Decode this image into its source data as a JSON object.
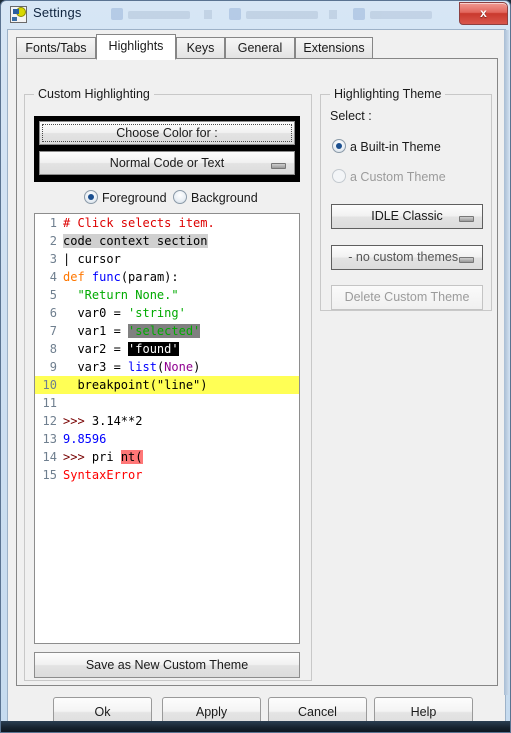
{
  "window": {
    "title": "Settings",
    "icon": "python-idle-icon",
    "close_label": "x"
  },
  "tabs": [
    {
      "label": "Fonts/Tabs",
      "active": false
    },
    {
      "label": "Highlights",
      "active": true
    },
    {
      "label": "Keys",
      "active": false
    },
    {
      "label": "General",
      "active": false
    },
    {
      "label": "Extensions",
      "active": false
    }
  ],
  "custom_highlighting": {
    "group_title": "Custom Highlighting",
    "choose_color_label": "Choose Color for :",
    "target_element": "Normal Code or Text",
    "fg_label": "Foreground",
    "bg_label": "Background",
    "fg_selected": true,
    "bg_selected": false,
    "save_theme_label": "Save as New Custom Theme"
  },
  "highlighting_theme": {
    "group_title": "Highlighting Theme",
    "select_label": "Select :",
    "builtin_label": "a Built-in Theme",
    "custom_label": "a Custom Theme",
    "builtin_selected": true,
    "custom_selected": false,
    "builtin_theme": "IDLE Classic",
    "custom_theme": "- no custom themes -",
    "delete_label": "Delete Custom Theme"
  },
  "code_sample": {
    "lines": [
      {
        "n": "1",
        "text": "# Click selects item."
      },
      {
        "n": "2",
        "text": "code context section"
      },
      {
        "n": "3",
        "text": "| cursor"
      },
      {
        "n": "4",
        "text": "def func(param):"
      },
      {
        "n": "5",
        "text": "  \"Return None.\""
      },
      {
        "n": "6",
        "text": "  var0 = 'string'"
      },
      {
        "n": "7",
        "text": "  var1 = 'selected'"
      },
      {
        "n": "8",
        "text": "  var2 = 'found'"
      },
      {
        "n": "9",
        "text": "  var3 = list(None)"
      },
      {
        "n": "10",
        "text": "  breakpoint(\"line\")"
      },
      {
        "n": "11",
        "text": ""
      },
      {
        "n": "12",
        "text": ">>> 3.14**2"
      },
      {
        "n": "13",
        "text": "9.8596"
      },
      {
        "n": "14",
        "text": ">>> pri nt("
      },
      {
        "n": "15",
        "text": "SyntaxError"
      }
    ]
  },
  "dialog_buttons": [
    {
      "label": "Ok"
    },
    {
      "label": "Apply"
    },
    {
      "label": "Cancel"
    },
    {
      "label": "Help"
    }
  ],
  "colors": {
    "comment": "#dd0000",
    "keyword": "#ff7700",
    "builtin": "#900090",
    "string": "#00aa00",
    "definition": "#0000ff",
    "console_prompt": "#770000",
    "console_output": "#0000ff",
    "error": "#ff0000",
    "hit_background": "#000000",
    "break_background": "#ffff55",
    "error_background": "#ff7777",
    "titlebar": "#cfe0f2",
    "close_button": "#c9392e"
  }
}
